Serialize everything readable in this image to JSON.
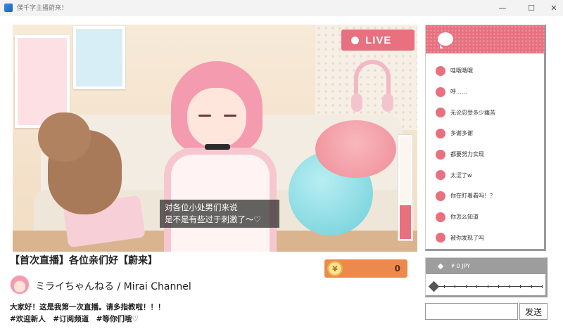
{
  "window": {
    "title": "僕千字主播蔚来！",
    "controls": [
      "minimize",
      "maximize",
      "close"
    ]
  },
  "stream": {
    "live_label": "LIVE",
    "subtitle_line1": "对各位小处男们来说",
    "subtitle_line2": "是不是有些过于刺激了～♡",
    "level": 0.33
  },
  "info": {
    "title": "【首次直播】各位亲们好【蔚来】",
    "channel_name": "ミライちゃんねる / Mirai Channel",
    "description_line1": "大家好！这是我第一次直播。请多指教啦！！！",
    "description_line2": "#欢迎新人　#订阅频道　#等你们哦♡"
  },
  "tip": {
    "coin_symbol": "¥",
    "value": "0"
  },
  "chat": {
    "icon": "chat-bubble-icon",
    "messages": [
      "哇哦哦哦",
      "呼……",
      "无论忍受多少痛苦",
      "多谢多谢",
      "都要努力实现",
      "太涩了w",
      "你在盯着看吗！？",
      "你怎么知道",
      "被你发现了吗"
    ]
  },
  "gift": {
    "amount_label": "¥ 0 JPY",
    "slider_value": 0
  },
  "input": {
    "placeholder": "",
    "send_label": "发送"
  },
  "colors": {
    "accent": "#e8707f",
    "tip": "#ec8a4d",
    "panel_header_gray": "#9d9d9d"
  }
}
